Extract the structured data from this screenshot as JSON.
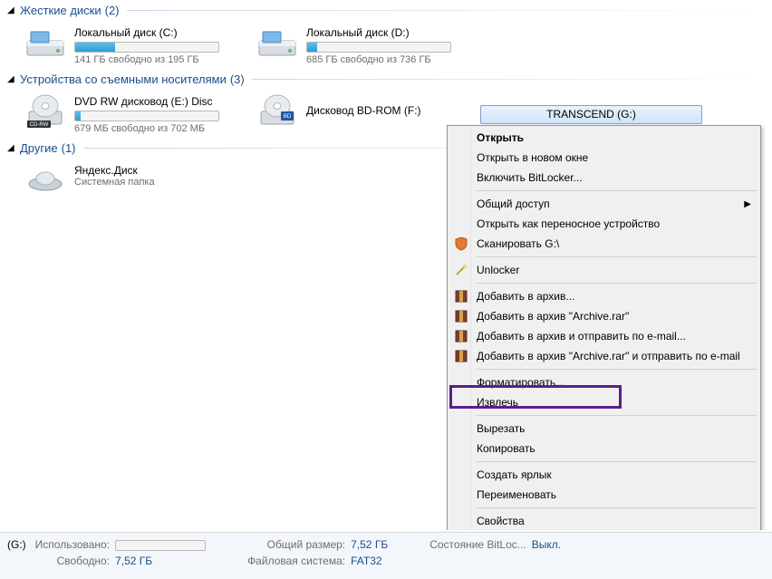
{
  "groups": {
    "hdd": {
      "title": "Жесткие диски",
      "count": "(2)"
    },
    "removable": {
      "title": "Устройства со съемными носителями",
      "count": "(3)"
    },
    "other": {
      "title": "Другие",
      "count": "(1)"
    }
  },
  "drives": {
    "c": {
      "title": "Локальный диск (C:)",
      "sub": "141 ГБ свободно из 195 ГБ",
      "fill": 28
    },
    "d": {
      "title": "Локальный диск (D:)",
      "sub": "685 ГБ свободно из 736 ГБ",
      "fill": 7
    },
    "e": {
      "title": "DVD RW дисковод (E:) Disc",
      "sub": "679 МБ свободно из 702 МБ",
      "fill": 4
    },
    "f": {
      "title": "Дисковод BD-ROM (F:)",
      "sub": ""
    },
    "yadisk": {
      "title": "Яндекс.Диск",
      "sub": "Системная папка"
    }
  },
  "selected": {
    "label": "TRANSCEND (G:)"
  },
  "context_menu": {
    "open": "Открыть",
    "open_new": "Открыть в новом окне",
    "bitlocker": "Включить BitLocker...",
    "share": "Общий доступ",
    "portable": "Открыть как переносное устройство",
    "scan": "Сканировать G:\\",
    "unlocker": "Unlocker",
    "add_archive": "Добавить в архив...",
    "add_archive_rar": "Добавить в архив \"Archive.rar\"",
    "add_email": "Добавить в архив и отправить по e-mail...",
    "add_rar_email": "Добавить в архив \"Archive.rar\" и отправить по e-mail",
    "format": "Форматировать...",
    "eject": "Извлечь",
    "cut": "Вырезать",
    "copy": "Копировать",
    "shortcut": "Создать ярлык",
    "rename": "Переименовать",
    "properties": "Свойства"
  },
  "status": {
    "drive_prefix": "(G:)",
    "used_label": "Использовано:",
    "free_label": "Свободно:",
    "free_val": "7,52 ГБ",
    "total_label": "Общий размер:",
    "total_val": "7,52 ГБ",
    "fs_label": "Файловая система:",
    "fs_val": "FAT32",
    "bitloc_label": "Состояние BitLoc...",
    "bitloc_val": "Выкл."
  }
}
